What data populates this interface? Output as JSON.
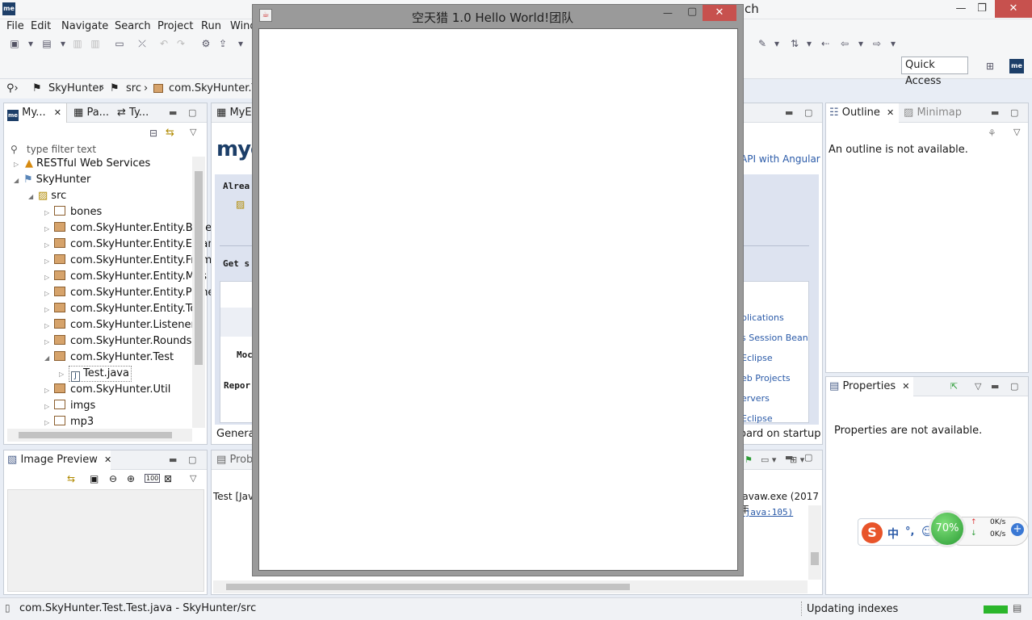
{
  "window": {
    "title_fragment": "ch",
    "minimize": "—",
    "maximize": "❐",
    "close": "✕"
  },
  "menu": [
    "File",
    "Edit",
    "Navigate",
    "Search",
    "Project",
    "Run",
    "Wind"
  ],
  "toolbar": {
    "quick_access": "Quick Access"
  },
  "breadcrumb": {
    "project": "SkyHunter",
    "folder": "src",
    "package": "com.SkyHunter.Tes"
  },
  "explorer": {
    "tabs": [
      "My...",
      "Pa...",
      "Ty..."
    ],
    "filter_placeholder": "type filter text",
    "tree": [
      {
        "label": "RESTful Web Services"
      },
      {
        "label": "SkyHunter"
      },
      {
        "label": "src"
      },
      {
        "label": "bones"
      },
      {
        "label": "com.SkyHunter.Entity.Bulle"
      },
      {
        "label": "com.SkyHunter.Entity.EPlan"
      },
      {
        "label": "com.SkyHunter.Entity.Fram"
      },
      {
        "label": "com.SkyHunter.Entity.Mus"
      },
      {
        "label": "com.SkyHunter.Entity.Plane"
      },
      {
        "label": "com.SkyHunter.Entity.Tool"
      },
      {
        "label": "com.SkyHunter.Listener"
      },
      {
        "label": "com.SkyHunter.Rounds"
      },
      {
        "label": "com.SkyHunter.Test"
      },
      {
        "label": "Test.java"
      },
      {
        "label": "com.SkyHunter.Util"
      },
      {
        "label": "imgs"
      },
      {
        "label": "mp3"
      }
    ]
  },
  "image_preview": {
    "tab": "Image Preview"
  },
  "editor": {
    "tab": "MyEc",
    "logo": "mye",
    "link_angular": "API with Angular",
    "text_alrea": "Alrea",
    "text_gets": "Get s",
    "text_moc": "Moc",
    "text_repor": "Repor",
    "links": [
      "plications",
      "s Session Bean",
      "Eclipse",
      "eb Projects",
      "ervers",
      "Eclipse"
    ],
    "general": "General",
    "onstartup": "oard on startup"
  },
  "console": {
    "tab": "Prob",
    "line": "Test [Jav",
    "javaw": "javaw.exe (2017年",
    "java_ref": ".java:105)"
  },
  "outline": {
    "tab": "Outline",
    "minimap_tab": "Minimap",
    "message": "An outline is not available."
  },
  "properties": {
    "tab": "Properties",
    "message": "Properties are not available."
  },
  "status": {
    "left": "com.SkyHunter.Test.Test.java - SkyHunter/src",
    "right": "Updating indexes"
  },
  "java_window": {
    "title": "空天猎   1.0   Hello World!团队",
    "minimize": "—",
    "maximize": "▢",
    "close": "✕"
  },
  "ime": {
    "text": "中",
    "punct": "°,"
  },
  "net": {
    "percent": "70%",
    "up": "0K/s",
    "down": "0K/s"
  }
}
